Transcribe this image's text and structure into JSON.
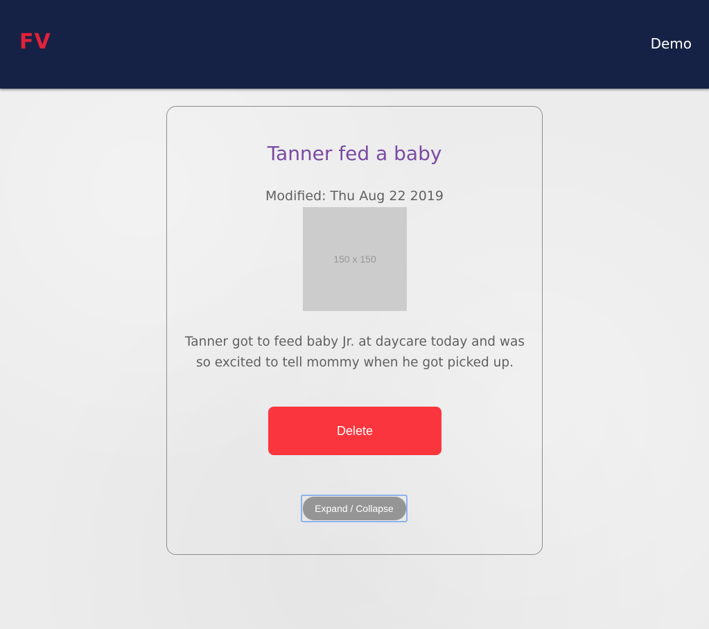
{
  "header": {
    "logo_text": "FV",
    "nav_link": "Demo"
  },
  "card": {
    "title": "Tanner fed a baby",
    "modified": "Modified: Thu Aug 22 2019",
    "image_placeholder": "150 x 150",
    "description": "Tanner got to feed baby Jr. at daycare today and was so excited to tell mommy when he got picked up.",
    "delete_label": "Delete",
    "expand_label": "Expand / Collapse"
  },
  "colors": {
    "header_bg": "#162245",
    "logo": "#e2213a",
    "title": "#7a4aa3",
    "delete_button": "#fb353d",
    "expand_button": "#959595",
    "focus_ring": "#8eb1ee"
  }
}
